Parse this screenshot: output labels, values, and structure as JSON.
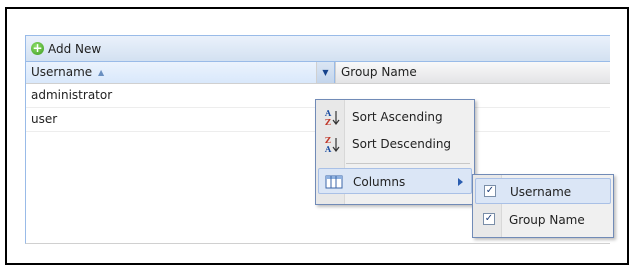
{
  "toolbar": {
    "add_label": "Add New"
  },
  "grid": {
    "columns": [
      {
        "label": "Username",
        "sorted": "asc"
      },
      {
        "label": "Group Name"
      }
    ],
    "rows": [
      {
        "username": "administrator",
        "group": ""
      },
      {
        "username": "user",
        "group": ""
      }
    ]
  },
  "column_menu": {
    "items": [
      {
        "label": "Sort Ascending",
        "icon": "sort-az-icon"
      },
      {
        "label": "Sort Descending",
        "icon": "sort-za-icon"
      },
      {
        "label": "Columns",
        "icon": "columns-icon",
        "has_submenu": true
      }
    ]
  },
  "columns_submenu": {
    "items": [
      {
        "label": "Username",
        "checked": true
      },
      {
        "label": "Group Name",
        "checked": true
      }
    ]
  },
  "colors": {
    "accent": "#99bbe8",
    "menu_border": "#718bb7",
    "active": "#dbe6f6"
  }
}
